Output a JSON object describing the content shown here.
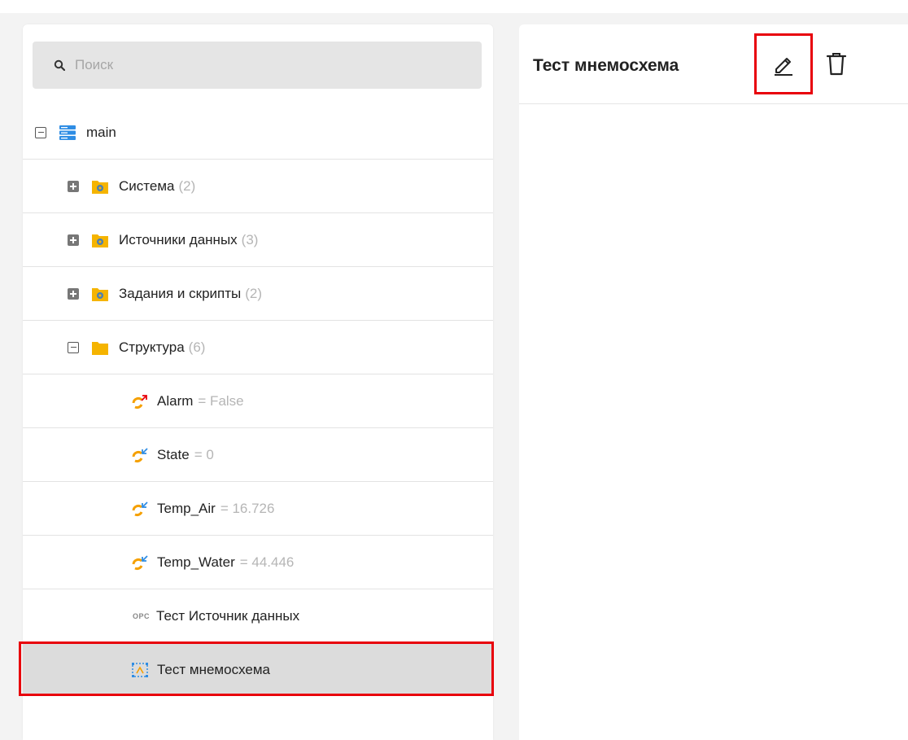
{
  "search": {
    "placeholder": "Поиск"
  },
  "tree": {
    "root": {
      "label": "main"
    },
    "folders": [
      {
        "label": "Система",
        "count": "(2)"
      },
      {
        "label": "Источники данных",
        "count": "(3)"
      },
      {
        "label": "Задания и скрипты",
        "count": "(2)"
      },
      {
        "label": "Структура",
        "count": "(6)"
      }
    ],
    "tags": [
      {
        "label": "Alarm",
        "value": "= False"
      },
      {
        "label": "State",
        "value": "= 0"
      },
      {
        "label": "Temp_Air",
        "value": "= 16.726"
      },
      {
        "label": "Temp_Water",
        "value": "= 44.446"
      }
    ],
    "datasource": {
      "icon_text": "OPC",
      "label": "Тест Источник данных"
    },
    "mnemo": {
      "label": "Тест мнемосхема"
    }
  },
  "detail": {
    "title": "Тест мнемосхема"
  },
  "colors": {
    "highlight": "#e8000b",
    "folder": "#f5b400",
    "server": "#2f8de4"
  }
}
